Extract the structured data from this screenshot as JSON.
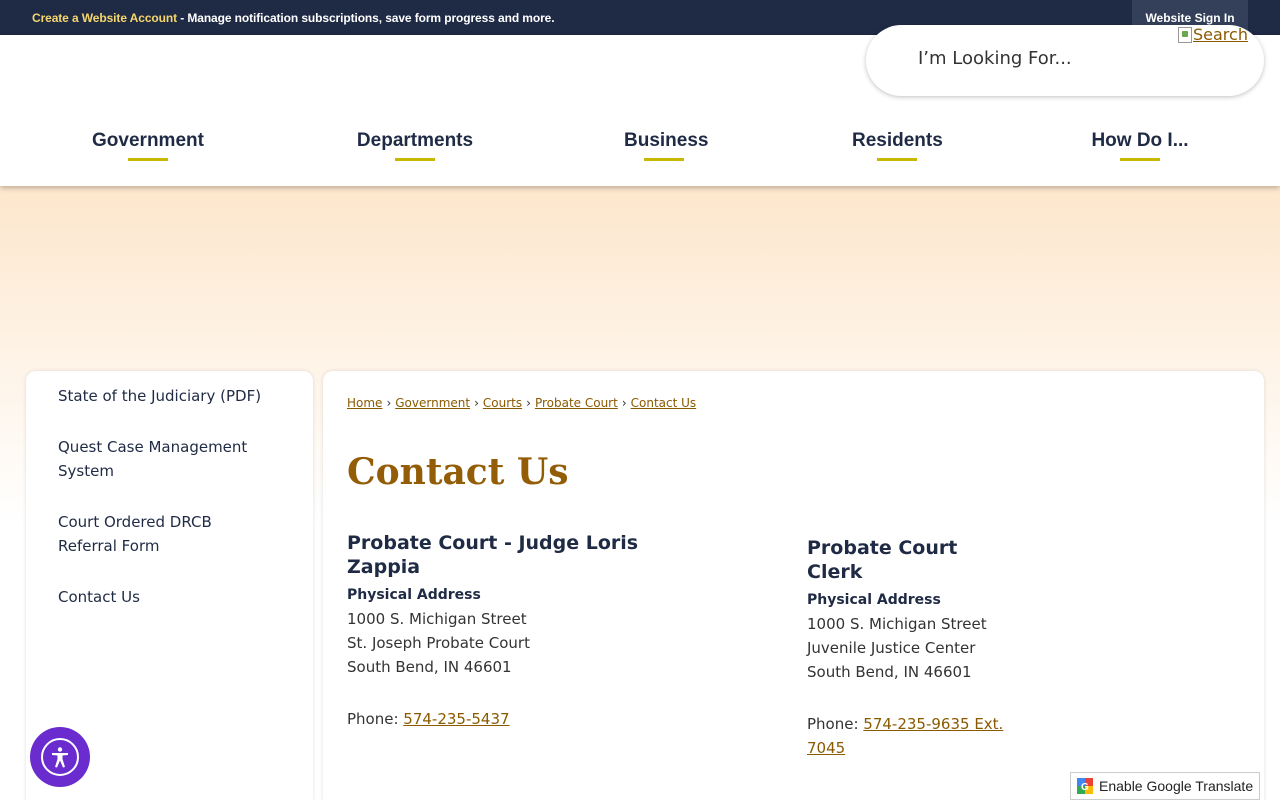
{
  "topbar": {
    "account_link": "Create a Website Account",
    "message": " - Manage notification subscriptions, save form progress and more.",
    "signin": "Website Sign In"
  },
  "search": {
    "placeholder": "I’m Looking For...",
    "button_alt": "Search"
  },
  "nav": {
    "items": [
      {
        "label": "Government"
      },
      {
        "label": "Departments"
      },
      {
        "label": "Business"
      },
      {
        "label": "Residents"
      },
      {
        "label": "How Do I..."
      }
    ]
  },
  "sidebar": {
    "items": [
      {
        "label": "State of the Judiciary (PDF)"
      },
      {
        "label": "Quest Case Management System"
      },
      {
        "label": "Court Ordered DRCB Referral Form"
      },
      {
        "label": "Contact Us"
      }
    ]
  },
  "breadcrumb": {
    "items": [
      "Home",
      "Government",
      "Courts",
      "Probate Court",
      "Contact Us"
    ],
    "separator": "›"
  },
  "page": {
    "title": "Contact Us"
  },
  "contacts": [
    {
      "name": "Probate Court - Judge Loris Zappia",
      "address_label": "Physical Address",
      "address_line1": "1000 S. Michigan Street",
      "address_line2": "St. Joseph Probate Court",
      "address_line3": "South Bend, IN 46601",
      "phone_label": "Phone: ",
      "phone": "574-235-5437"
    },
    {
      "name": "Probate Court Clerk",
      "address_label": "Physical Address",
      "address_line1": "1000 S. Michigan Street",
      "address_line2": "Juvenile Justice Center",
      "address_line3": "South Bend, IN 46601",
      "phone_label": "Phone: ",
      "phone": "574-235-9635 Ext. 7045"
    }
  ],
  "translate": {
    "label": "Enable Google Translate"
  },
  "colors": {
    "navy": "#1f2a44",
    "gold_underline": "#c8b900",
    "title_brown": "#935c06",
    "link_brown": "#8a5a00",
    "a11y_purple": "#6a2ccf"
  }
}
